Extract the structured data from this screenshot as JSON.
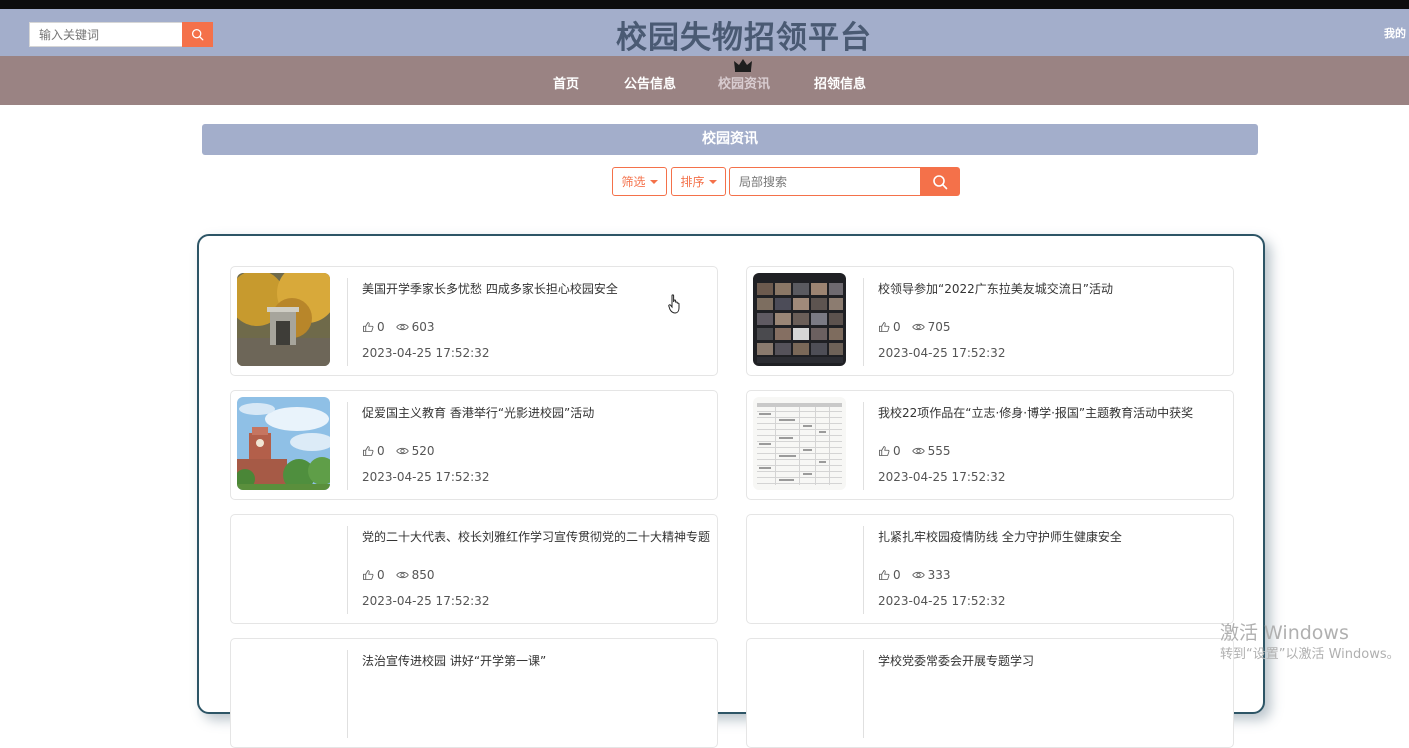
{
  "header": {
    "search_placeholder": "输入关键词",
    "title": "校园失物招领平台",
    "my_link": "我的"
  },
  "nav": {
    "items": [
      {
        "label": "首页",
        "active": false
      },
      {
        "label": "公告信息",
        "active": false
      },
      {
        "label": "校园资讯",
        "active": true
      },
      {
        "label": "招领信息",
        "active": false
      }
    ]
  },
  "section": {
    "title": "校园资讯",
    "filter_label": "筛选",
    "sort_label": "排序",
    "search_placeholder": "局部搜索"
  },
  "cards": [
    {
      "title": "美国开学季家长多忧愁 四成多家长担心校园安全",
      "likes": "0",
      "views": "603",
      "date": "2023-04-25 17:52:32",
      "image": "autumn-campus-gate"
    },
    {
      "title": "校领导参加“2022广东拉美友城交流日”活动",
      "likes": "0",
      "views": "705",
      "date": "2023-04-25 17:52:32",
      "image": "video-conference-grid"
    },
    {
      "title": "促爱国主义教育 香港举行“光影进校园”活动",
      "likes": "0",
      "views": "520",
      "date": "2023-04-25 17:52:32",
      "image": "clock-tower-sky"
    },
    {
      "title": "我校22项作品在“立志·修身·博学·报国”主题教育活动中获奖",
      "likes": "0",
      "views": "555",
      "date": "2023-04-25 17:52:32",
      "image": "award-table-document"
    },
    {
      "title": "党的二十大代表、校长刘雅红作学习宣传贯彻党的二十大精神专题",
      "likes": "0",
      "views": "850",
      "date": "2023-04-25 17:52:32",
      "image": ""
    },
    {
      "title": "扎紧扎牢校园疫情防线 全力守护师生健康安全",
      "likes": "0",
      "views": "333",
      "date": "2023-04-25 17:52:32",
      "image": ""
    },
    {
      "title": "法治宣传进校园 讲好“开学第一课”",
      "likes": "",
      "views": "",
      "date": "",
      "image": ""
    },
    {
      "title": "学校党委常委会开展专题学习",
      "likes": "",
      "views": "",
      "date": "",
      "image": ""
    }
  ],
  "watermark": {
    "line1": "激活 Windows",
    "line2": "转到“设置”以激活 Windows。"
  },
  "colors": {
    "header_bg": "#a3aecb",
    "nav_bg": "#9a8383",
    "accent": "#f4714a",
    "panel_border": "#2d5566"
  }
}
